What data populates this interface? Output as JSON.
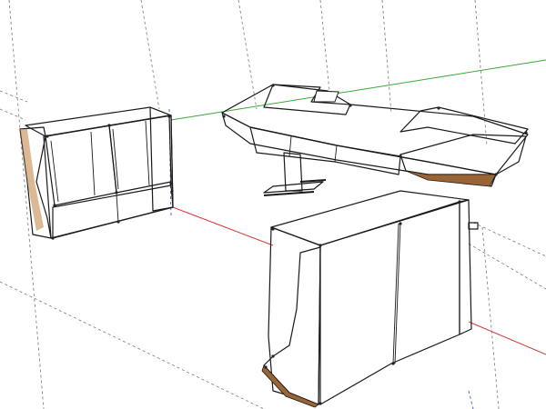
{
  "viewport": {
    "background": "#ffffff",
    "colors": {
      "grid_line": "#7a7a7a",
      "axis_red": "#d43a3a",
      "axis_green": "#3aa83a",
      "panel_dark": "#4a4a4a",
      "panel_mid": "#5a5a5a",
      "panel_light": "#6a6a6a",
      "wood_light": "#d4a066",
      "wood_dark": "#a8703c",
      "edge": "#1a1a1a"
    }
  }
}
